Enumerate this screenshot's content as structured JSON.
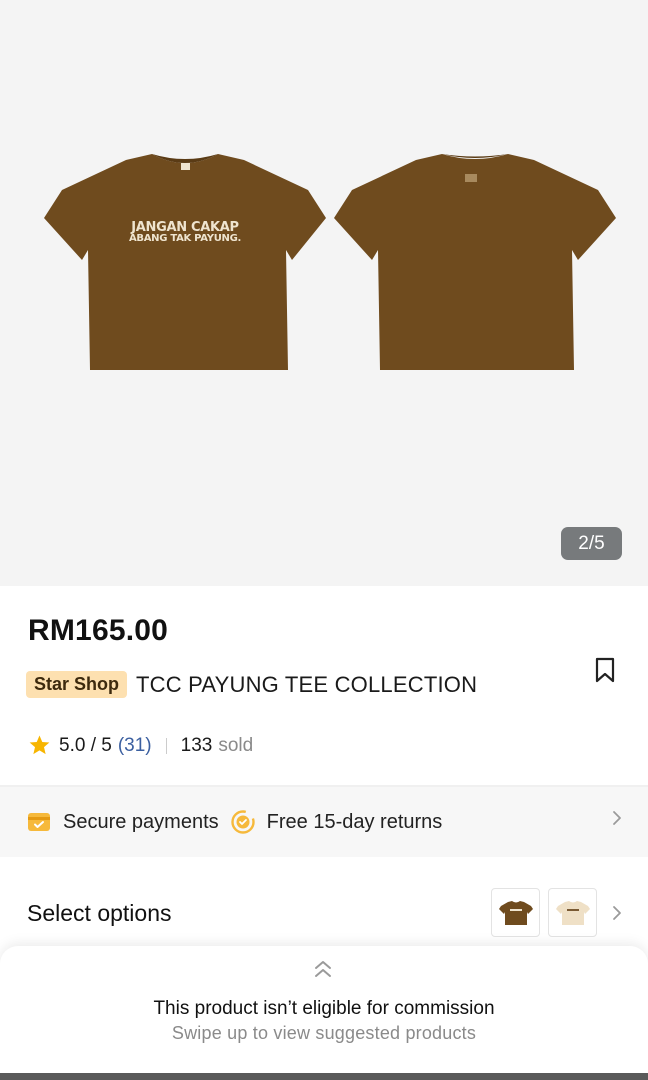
{
  "gallery": {
    "counter": "2/5",
    "front_print_line1": "JANGAN CAKAP",
    "front_print_line2": "ABANG TAK PAYUNG.",
    "tee_color": "#6f4b1e"
  },
  "product": {
    "price": "RM165.00",
    "shop_tag": "Star Shop",
    "title": "TCC PAYUNG TEE COLLECTION"
  },
  "rating": {
    "score": "5.0 / 5",
    "review_count": "(31)",
    "sold_count": "133",
    "sold_label": "sold"
  },
  "perks": {
    "secure_label": "Secure payments",
    "returns_label": "Free 15-day returns"
  },
  "options": {
    "title": "Select options"
  },
  "sheet": {
    "title": "This product isn’t eligible for commission",
    "subtitle": "Swipe up to view suggested products"
  },
  "colors": {
    "accent_tag": "#fde0b0",
    "review_link": "#3b5fa0",
    "star": "#f7b500",
    "perk_icon": "#f6b93b"
  },
  "icons": [
    "bookmark-icon",
    "star-icon",
    "secure-payment-icon",
    "returns-icon",
    "chevron-right-icon",
    "double-chevron-up-icon"
  ]
}
